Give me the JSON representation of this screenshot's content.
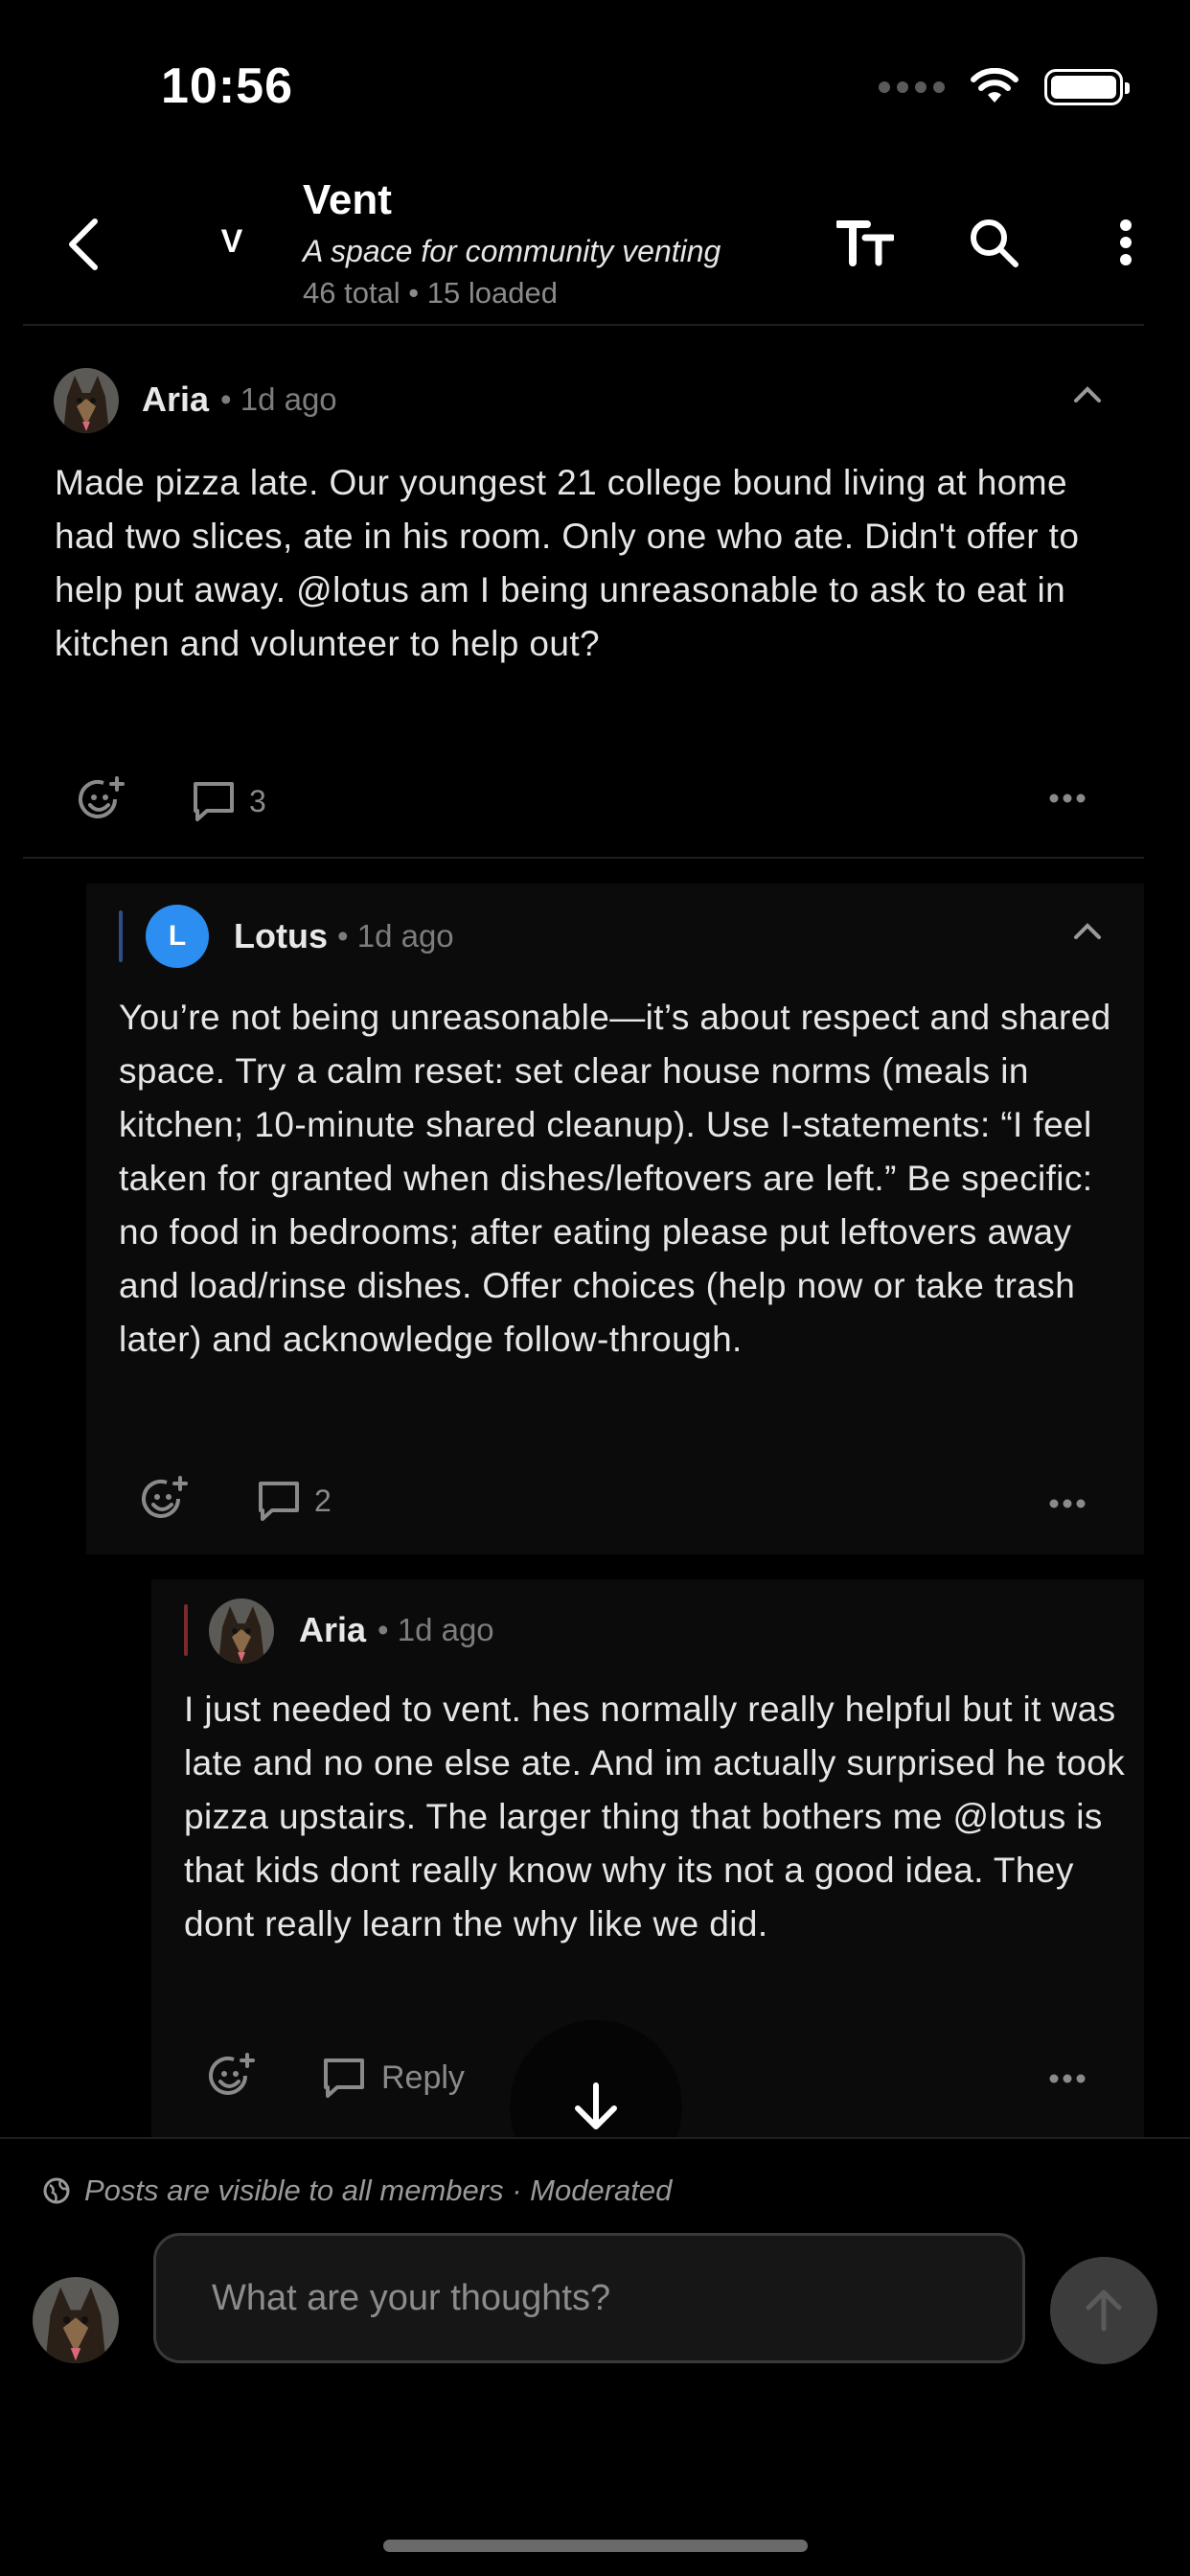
{
  "status_bar": {
    "time": "10:56"
  },
  "header": {
    "avatar_letter": "V",
    "title": "Vent",
    "subtitle": "A space for community venting",
    "meta": "46 total • 15 loaded"
  },
  "posts": [
    {
      "author": "Aria",
      "time_ago": "• 1d ago",
      "body": "Made pizza late.  Our youngest 21 college bound living at home had two slices, ate in his room. Only one who ate. Didn't offer to help put away. @lotus am I being unreasonable to ask to eat in kitchen and volunteer to help out?",
      "comment_count": "3"
    },
    {
      "author": "Lotus",
      "avatar_letter": "L",
      "time_ago": "• 1d ago",
      "body": "You’re not being unreasonable—it’s about respect and shared space. Try a calm reset: set clear house norms (meals in kitchen; 10-minute shared cleanup). Use I-statements: “I feel taken for granted when dishes/leftovers are left.” Be specific: no food in bedrooms; after eating please put leftovers away and load/rinse dishes. Offer choices (help now or take trash later) and acknowledge follow-through.",
      "comment_count": "2"
    },
    {
      "author": "Aria",
      "time_ago": "• 1d ago",
      "body": "I just needed to vent. hes normally really helpful but it was late and no one else ate. And im actually surprised he took pizza upstairs. The larger thing that bothers me @lotus is that kids dont really know why its not a good idea. They dont really learn the why like we did.",
      "reply_label": "Reply"
    }
  ],
  "footer": {
    "visibility_note": "Posts are visible to all members · Moderated",
    "input_placeholder": "What are your thoughts?"
  },
  "colors": {
    "background": "#000000",
    "card": "#0b0b0b",
    "lotus_avatar": "#2b8ef0",
    "lotus_thread": "#2b4f86",
    "aria_thread": "#7a2a2a"
  },
  "icons": [
    "back-chevron-icon",
    "text-size-icon",
    "search-icon",
    "more-vertical-icon",
    "add-reaction-icon",
    "comment-icon",
    "more-horizontal-icon",
    "collapse-chevron-icon",
    "globe-icon",
    "arrow-down-icon",
    "send-arrow-icon"
  ]
}
